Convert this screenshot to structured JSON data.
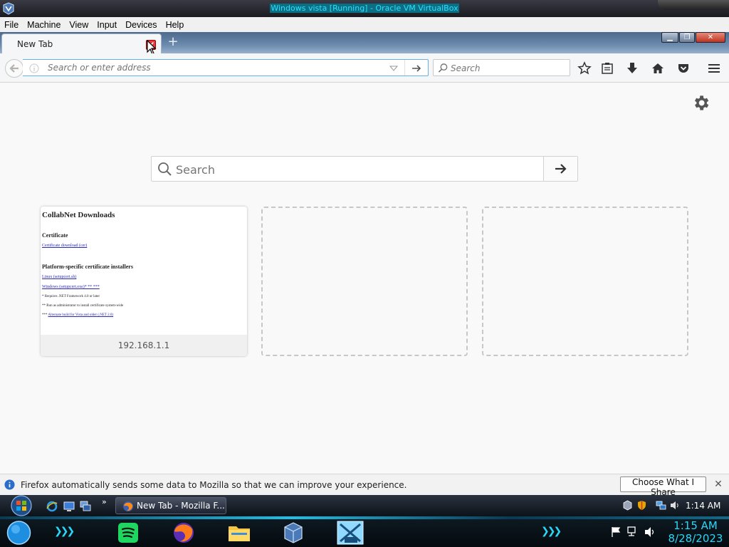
{
  "window": {
    "title": "Windows vista [Running] - Oracle VM VirtualBox"
  },
  "vbox_menu": [
    "File",
    "Machine",
    "View",
    "Input",
    "Devices",
    "Help"
  ],
  "firefox": {
    "tab_title": "New Tab",
    "new_tab_symbol": "+",
    "url_placeholder": "Search or enter address",
    "search_placeholder": "Search",
    "window_buttons": {
      "minimize": "▁",
      "maximize": "❐",
      "close": "✕"
    }
  },
  "newtab": {
    "search_placeholder": "Search",
    "tiles": [
      {
        "caption": "192.168.1.1",
        "thumbnail": {
          "title": "CollabNet Downloads",
          "section1": "Certificate",
          "link1": "Certificate download (cer)",
          "section2": "Platform-specific certificate installers",
          "link2": "Linux (setupcert.sh)",
          "link3": "Windows (setupcert.exe)* ** ***",
          "note1": "* Requires .NET Framework 4.0 or later",
          "note2": "** Run as administrator to install certificate system-wide",
          "note3_prefix": "***",
          "note3_link": "Alternate build for Vista and older (.NET 2.0)"
        }
      }
    ]
  },
  "notification": {
    "text": "Firefox automatically sends some data to Mozilla so that we can improve your experience.",
    "button": "Choose What I Share",
    "close": "✕"
  },
  "vista_taskbar": {
    "more": "»",
    "task_label": "New Tab - Mozilla F...",
    "clock": "1:14 AM"
  },
  "host_taskbar": {
    "time": "1:15 AM",
    "date": "8/28/2023",
    "chevrons": "❯❯❯"
  },
  "colors": {
    "title_text": "#28e0ff",
    "urlbar_focus": "#6ab0e6",
    "accent_cyan": "#28d7f7"
  }
}
